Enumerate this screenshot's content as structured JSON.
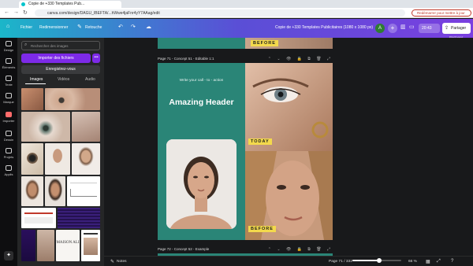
{
  "browser": {
    "tab_title": "Copie de +330 Templates Pub...",
    "url": "canva.com/design/DAGU_IBEFTA/...hWwe4jaFnr4yY7AAag/edit",
    "update_button": "Redémarrer pour mettre à jour"
  },
  "toolbar": {
    "file": "Fichier",
    "resize": "Redimensionner",
    "retouch": "Retouche",
    "doc_title": "Copie de +330 Templates Publicitaires (1080 x 1080 px)",
    "avatar_initial": "A",
    "timer": "20:43",
    "share": "Partager",
    "share_tooltip": "Partager"
  },
  "rail": {
    "items": [
      "Design",
      "Éléments",
      "Texte",
      "Marque",
      "Importer",
      "Dessin",
      "Projets",
      "Applis"
    ]
  },
  "panel": {
    "search_placeholder": "Rechercher des images",
    "import_button": "Importer des fichiers",
    "import_more": "•••",
    "record_button": "Enregistrez-vous",
    "tabs": [
      "Images",
      "Vidéos",
      "Audio"
    ],
    "brand_thumb_text": "MAISON ALI"
  },
  "workspace": {
    "top_badge": "BEFORE",
    "page71_label": "Page 71 - Concept 51 - Editable 1:1",
    "page72_label": "Page 72 - Concept 52 - Example",
    "cta_text": "Write your call - to - action",
    "headline": "Amazing Header",
    "badge_today": "TODAY",
    "badge_before": "BEFORE",
    "page_tools": "⌃ ⌄ 👁 🔒 ⧉ 🗑 ⤢"
  },
  "bottombar": {
    "notes": "Notes",
    "page_counter": "Page 71 / 332",
    "zoom": "66 %",
    "zoom_fraction": 0.55
  },
  "colors": {
    "accent": "#7d2ae8",
    "teal": "#2a8577",
    "badge": "#f3d94c"
  }
}
